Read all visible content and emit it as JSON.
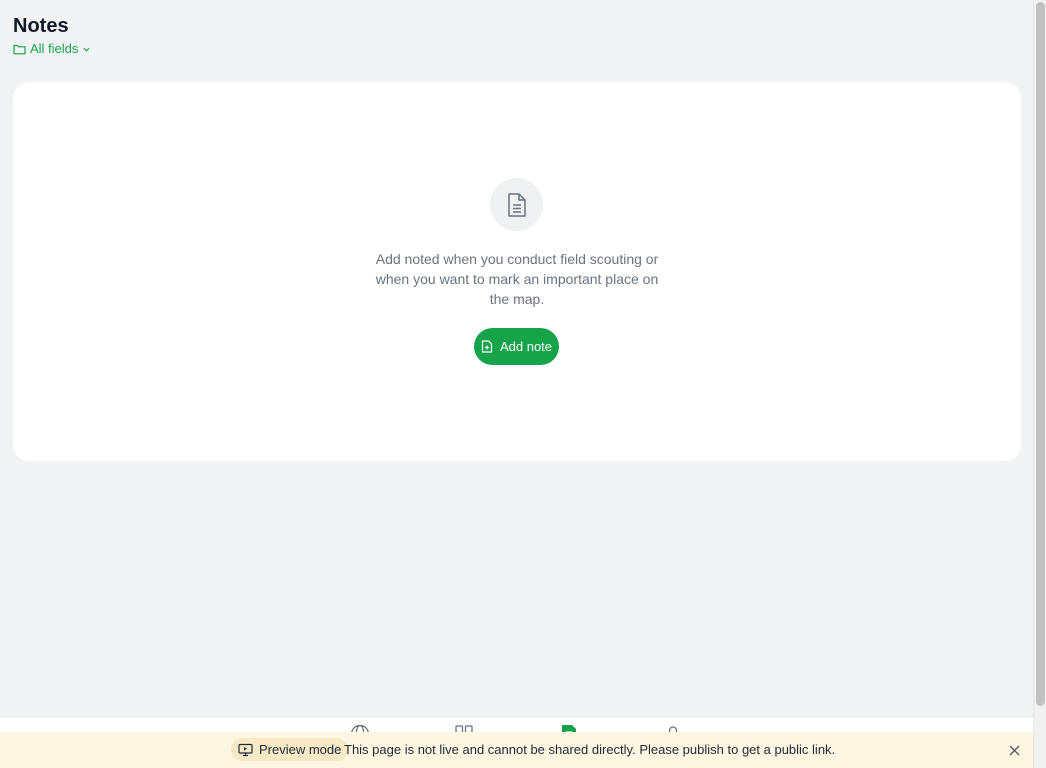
{
  "header": {
    "title": "Notes",
    "field_filter_label": "All fields"
  },
  "empty_state": {
    "message": "Add noted when you conduct field scouting or when you want to mark an important place on the map.",
    "add_note_label": "Add note"
  },
  "bottom_nav": {
    "items": [
      {
        "icon": "globe-icon"
      },
      {
        "icon": "grid-icon"
      },
      {
        "icon": "note-icon",
        "active": true
      },
      {
        "icon": "user-icon"
      }
    ]
  },
  "banner": {
    "preview_label": "Preview mode",
    "message": "This page is not live and cannot be shared directly. Please publish to get a public link."
  },
  "colors": {
    "accent": "#16a34a",
    "background": "#f2f3f5",
    "banner_bg": "#fdf6e0"
  }
}
